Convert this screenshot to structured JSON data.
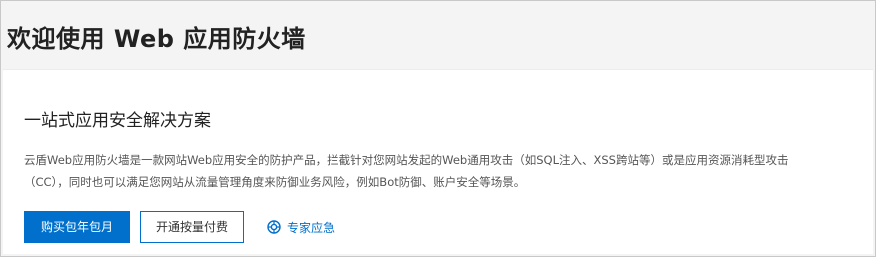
{
  "header": {
    "title": "欢迎使用 Web 应用防火墙"
  },
  "card": {
    "title": "一站式应用安全解决方案",
    "description": "云盾Web应用防火墙是一款网站Web应用安全的防护产品，拦截针对您网站发起的Web通用攻击（如SQL注入、XSS跨站等）或是应用资源消耗型攻击（CC），同时也可以满足您网站从流量管理角度来防御业务风险，例如Bot防御、账户安全等场景。",
    "buttons": {
      "subscription_label": "购买包年包月",
      "pay_as_you_go_label": "开通按量付费"
    },
    "expert_link": {
      "icon": "expert-emergency-icon",
      "label": "专家应急"
    }
  },
  "colors": {
    "accent": "#0070cc",
    "background": "#f4f4f4",
    "card": "#ffffff"
  }
}
